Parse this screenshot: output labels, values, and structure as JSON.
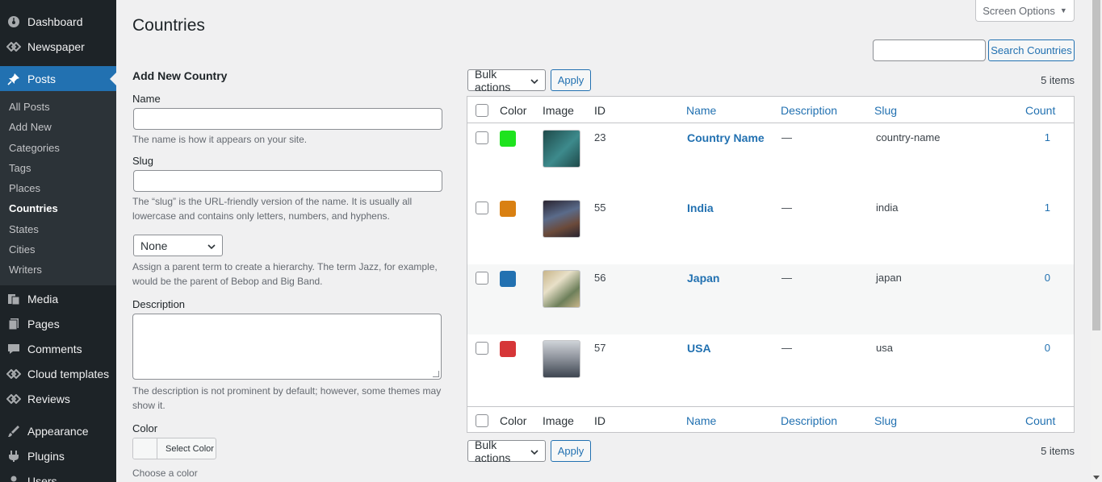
{
  "sidebar": {
    "items_top": [
      {
        "label": "Dashboard",
        "icon": "dashboard-icon"
      },
      {
        "label": "Newspaper",
        "icon": "newspaper-icon"
      }
    ],
    "posts": {
      "label": "Posts",
      "icon": "pin-icon"
    },
    "posts_submenu": [
      "All Posts",
      "Add New",
      "Categories",
      "Tags",
      "Places",
      "Countries",
      "States",
      "Cities",
      "Writers"
    ],
    "current_submenu": "Countries",
    "items_bottom": [
      {
        "label": "Media",
        "icon": "media-icon"
      },
      {
        "label": "Pages",
        "icon": "pages-icon"
      },
      {
        "label": "Comments",
        "icon": "comments-icon"
      },
      {
        "label": "Cloud templates",
        "icon": "cloud-templates-icon"
      },
      {
        "label": "Reviews",
        "icon": "reviews-icon"
      },
      {
        "label": "Appearance",
        "icon": "appearance-icon"
      },
      {
        "label": "Plugins",
        "icon": "plugins-icon"
      },
      {
        "label": "Users",
        "icon": "users-icon"
      }
    ]
  },
  "header": {
    "title": "Countries",
    "screen_options": "Screen Options",
    "search_button": "Search Countries"
  },
  "form": {
    "title": "Add New Country",
    "name_label": "Name",
    "name_help": "The name is how it appears on your site.",
    "slug_label": "Slug",
    "slug_help": "The “slug” is the URL-friendly version of the name. It is usually all lowercase and contains only letters, numbers, and hyphens.",
    "parent_value": "None",
    "parent_help": "Assign a parent term to create a hierarchy. The term Jazz, for example, would be the parent of Bebop and Big Band.",
    "description_label": "Description",
    "description_help": "The description is not prominent by default; however, some themes may show it.",
    "color_label": "Color",
    "color_button": "Select Color",
    "color_help": "Choose a color"
  },
  "table": {
    "bulk_actions": "Bulk actions",
    "apply": "Apply",
    "items_count": "5 items",
    "columns": {
      "color": "Color",
      "image": "Image",
      "id": "ID",
      "name": "Name",
      "description": "Description",
      "slug": "Slug",
      "count": "Count"
    },
    "rows": [
      {
        "color": "#1ee31e",
        "id": "23",
        "name": "Country Name",
        "description": "—",
        "slug": "country-name",
        "count": "1",
        "thumb": [
          "#1f4a4a",
          "#3d8a8c"
        ]
      },
      {
        "color": "#d98012",
        "id": "55",
        "name": "India",
        "description": "—",
        "slug": "india",
        "count": "1",
        "thumb": [
          "#2a2430",
          "#6b4a3a"
        ]
      },
      {
        "color": "#2271b1",
        "id": "56",
        "name": "Japan",
        "description": "—",
        "slug": "japan",
        "count": "0",
        "thumb": [
          "#c8b58a",
          "#6d7f5a"
        ]
      },
      {
        "color": "#d63638",
        "id": "57",
        "name": "USA",
        "description": "—",
        "slug": "usa",
        "count": "0",
        "thumb": [
          "#8a8f98",
          "#3d4550"
        ]
      }
    ]
  }
}
